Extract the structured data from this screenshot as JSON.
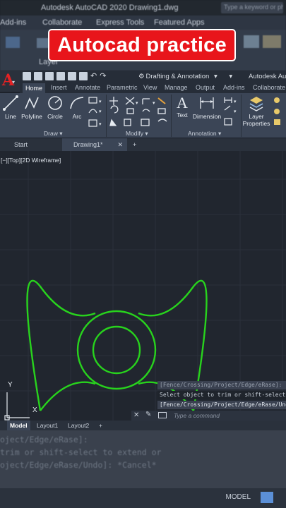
{
  "background_app": {
    "title": "Autodesk AutoCAD 2020   Drawing1.dwg",
    "search_placeholder": "Type a keyword or phrase",
    "menu": [
      "Add-ins",
      "Collaborate",
      "Express Tools",
      "Featured Apps"
    ],
    "ribbon_partial": "Layer"
  },
  "banner": {
    "text": "Autocad practice",
    "color": "#e8151b"
  },
  "quick_access": {
    "workspace": "Drafting & Annotation",
    "app_name": "Autodesk Auto"
  },
  "ribbon_tabs": [
    "Home",
    "Insert",
    "Annotate",
    "Parametric",
    "View",
    "Manage",
    "Output",
    "Add-ins",
    "Collaborate"
  ],
  "active_tab": "Home",
  "ribbon": {
    "draw_tools": [
      "Line",
      "Polyline",
      "Circle",
      "Arc"
    ],
    "draw_panel": "Draw",
    "modify_panel": "Modify",
    "annotation_tools": [
      "Text",
      "Dimension"
    ],
    "annotation_panel": "Annotation",
    "layer_tool": [
      "Layer",
      "Properties"
    ]
  },
  "file_tabs": {
    "start": "Start",
    "drawing": "Drawing1*",
    "close": "✕",
    "add": "+"
  },
  "viewport": {
    "label": "[−][Top][2D Wireframe]",
    "drawing_color": "#28d31d"
  },
  "command_history": [
    "[Fence/Crossing/Project/Edge/eRase]:",
    "Select object to trim or shift-select to",
    "[Fence/Crossing/Project/Edge/eRase/Undo]"
  ],
  "command_line": {
    "placeholder": "Type a command"
  },
  "layout_tabs": [
    "Model",
    "Layout1",
    "Layout2",
    "+"
  ],
  "background_bottom": {
    "lines": [
      "oject/Edge/eRase]:",
      "trim or shift-select to extend or",
      "oject/Edge/eRase/Undo]: *Cancel*"
    ],
    "status_model": "MODEL"
  },
  "ucs": {
    "y": "Y",
    "x": "X"
  }
}
